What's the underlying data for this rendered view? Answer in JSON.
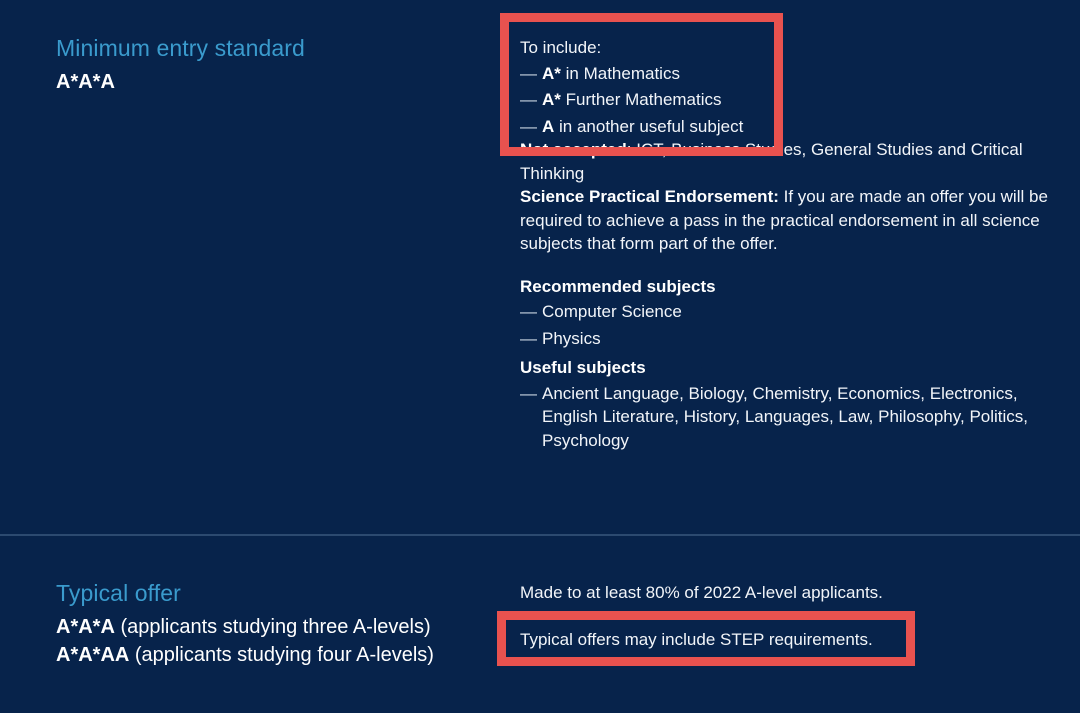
{
  "theme": {
    "background": "#07234b",
    "heading_color": "#3a9bcd",
    "text_color": "#f2f5f9",
    "annotation_red": "#e8524f",
    "divider_color": "#2c4a70"
  },
  "sections": {
    "minimum_entry_standard": {
      "heading": "Minimum entry standard",
      "grade": "A*A*A",
      "to_include": {
        "label": "To include:",
        "items": [
          {
            "bold": "A*",
            "rest": " in Mathematics"
          },
          {
            "bold": "A*",
            "rest": " Further Mathematics"
          },
          {
            "bold": "A",
            "rest": " in another useful subject"
          }
        ]
      },
      "not_accepted": {
        "label": "Not accepted",
        "text": ": ICT, Business Studies, General Studies and Critical Thinking"
      },
      "science_practical_endorsement": {
        "label": "Science Practical Endorsement:",
        "text": " If you are made an offer you will be required to achieve a pass in the practical endorsement in all science subjects that form part of the offer."
      },
      "recommended_subjects": {
        "heading": "Recommended subjects",
        "items": [
          "Computer Science",
          "Physics"
        ]
      },
      "useful_subjects": {
        "heading": "Useful subjects",
        "items": [
          "Ancient Language, Biology, Chemistry, Economics, Electronics, English Literature, History, Languages, Law, Philosophy, Politics, Psychology"
        ]
      }
    },
    "typical_offer": {
      "heading": "Typical offer",
      "grades": [
        {
          "bold": "A*A*A",
          "rest": " (applicants studying three A-levels)"
        },
        {
          "bold": "A*A*AA",
          "rest": " (applicants studying four A-levels)"
        }
      ],
      "made_to_note": "Made to at least 80% of 2022 A-level applicants.",
      "step_note": "Typical offers may include STEP requirements."
    }
  },
  "annotations": {
    "highlight_to_include": "To include list highlighted",
    "highlight_step": "STEP requirements note highlighted"
  }
}
